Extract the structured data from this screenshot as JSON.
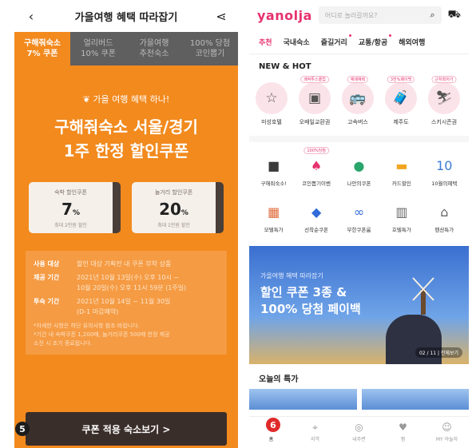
{
  "left": {
    "header": {
      "title": "가을여행 혜택 따라잡기",
      "back_icon": "‹",
      "share_icon": "⋖"
    },
    "tabs": [
      {
        "label": "구해줘숙소\n7% 쿠폰",
        "active": true
      },
      {
        "label": "얼리버드\n10% 쿠폰",
        "active": false
      },
      {
        "label": "가을여행\n추천숙소",
        "active": false
      },
      {
        "label": "100% 당첨\n코인뽑기",
        "active": false
      }
    ],
    "eyebrow": "가을 여행 혜택 하나!",
    "headline": "구해줘숙소 서울/경기\n1주 한정 할인쿠폰",
    "coupons": [
      {
        "label": "숙박 할인쿠폰",
        "value": "7",
        "unit": "%",
        "sub": "최대 2만원 할인"
      },
      {
        "label": "놀거리 할인쿠폰",
        "value": "20",
        "unit": "%",
        "sub": "최대 1만원 할인"
      }
    ],
    "info": [
      {
        "key": "사용 대상",
        "value": "할인 대상 기획전 내 쿠폰 부착 상품"
      },
      {
        "key": "제공 기간",
        "value": "2021년 10월 13일(수) 오후 10시 ~\n10월 20일(수) 오후 11시 59분 (1주일)"
      },
      {
        "key": "투숙 기간",
        "value": "2021년 10월 14일 ~ 11월 30일\n(D-1 마감예약)"
      }
    ],
    "notes": "*자세한 사항은 하단 유의사항 참조 바랍니다.\n*기간 내 숙박쿠폰 1,200매, 놀거리쿠폰 500매 한정 제공\n소진 시 조기 종료됩니다.",
    "cta": "쿠폰 적용 숙소보기 >",
    "badge": "5"
  },
  "right": {
    "logo": "yanolja",
    "search": {
      "placeholder": "어디로 놀러갈까요?"
    },
    "tabs": [
      {
        "label": "추천",
        "active": true,
        "dot": false
      },
      {
        "label": "국내숙소",
        "active": false,
        "dot": false
      },
      {
        "label": "즐길거리",
        "active": false,
        "dot": true
      },
      {
        "label": "교통/항공",
        "active": false,
        "dot": true
      },
      {
        "label": "해외여행",
        "active": false,
        "dot": false
      }
    ],
    "hot_title": "NEW & HOT",
    "hot_items": [
      {
        "label": "미성호텔",
        "tag": "",
        "icon": "☆"
      },
      {
        "label": "오배일교환권",
        "tag": "쾌적투스쿨럽",
        "icon": "▣"
      },
      {
        "label": "고속버스",
        "tag": "예매혜택",
        "icon": "🚌"
      },
      {
        "label": "제주도",
        "tag": "3천%페이백",
        "icon": "🧳"
      },
      {
        "label": "스키시즌권",
        "tag": "근처최저가",
        "icon": "⛷"
      }
    ],
    "grid_items": [
      {
        "label": "구해줘숙소!",
        "tag": "",
        "icon": "■",
        "color": "#3b3b3b"
      },
      {
        "label": "코인뽑기이벤",
        "tag": "100%당첨",
        "icon": "♠",
        "color": "#e6326e"
      },
      {
        "label": "나만의쿠폰",
        "tag": "",
        "icon": "●",
        "color": "#2aa56b"
      },
      {
        "label": "카드할인",
        "tag": "",
        "icon": "▬",
        "color": "#f2a51e"
      },
      {
        "label": "10월의혜택",
        "tag": "",
        "icon": "10",
        "color": "#3a7bd5"
      },
      {
        "label": "모텔특가",
        "tag": "",
        "icon": "▦",
        "color": "#e06a3a"
      },
      {
        "label": "선착순쿠폰",
        "tag": "",
        "icon": "◆",
        "color": "#2f6bd9"
      },
      {
        "label": "무한쿠폰룸",
        "tag": "",
        "icon": "∞",
        "color": "#2f6bd9"
      },
      {
        "label": "호텔특가",
        "tag": "",
        "icon": "▥",
        "color": "#666666"
      },
      {
        "label": "펜션특가",
        "tag": "",
        "icon": "⌂",
        "color": "#666666"
      }
    ],
    "banner": {
      "sub": "가을여행 혜택 따라잡기",
      "main": "할인 쿠폰 3종 &\n100% 당첨 페이백",
      "pager": "02 / 11 | 전체보기"
    },
    "daily_title": "오늘의 특가",
    "bottom_nav": [
      {
        "label": "홈",
        "icon": "⌂",
        "active": true
      },
      {
        "label": "지역",
        "icon": "⌖",
        "active": false
      },
      {
        "label": "내주변",
        "icon": "◎",
        "active": false
      },
      {
        "label": "찜",
        "icon": "♥",
        "active": false
      },
      {
        "label": "MY 야놀자",
        "icon": "☺",
        "active": false
      }
    ],
    "badge": "6"
  }
}
